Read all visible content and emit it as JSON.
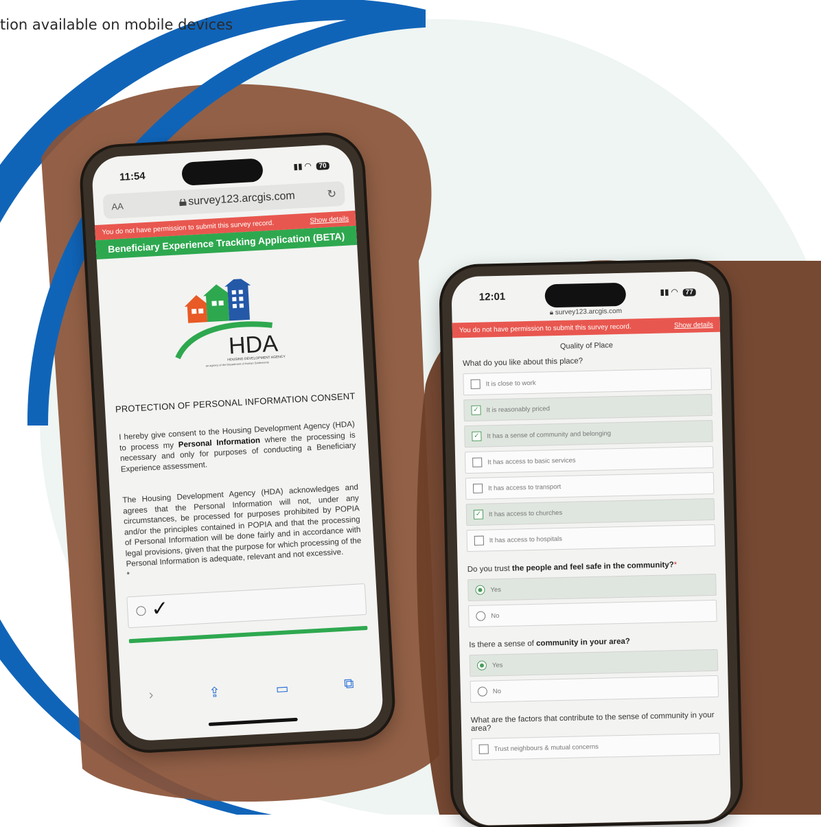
{
  "caption": "tion available on mobile devices",
  "colors": {
    "accent_blue": "#1064b8",
    "green": "#2ea84f",
    "warning_red": "#e8574f"
  },
  "phone1": {
    "time": "11:54",
    "battery": "70",
    "aa_label": "AA",
    "url": "survey123.arcgis.com",
    "warning": "You do not have permission to submit this survey record.",
    "show_details": "Show details",
    "app_title": "Beneficiary Experience Tracking Application (BETA)",
    "logo_text": "HDA",
    "logo_sub": "HOUSING DEVELOPMENT AGENCY",
    "logo_sub2": "an agency of the Department of Human Settlements",
    "consent_title": "PROTECTION OF PERSONAL INFORMATION CONSENT",
    "para1_before": "I hereby give consent to the Housing Development Agency (HDA) to process my ",
    "para1_bold": "Personal Information",
    "para1_after": " where the processing is necessary and only for purposes of conducting a Beneficiary Experience assessment.",
    "para2": "The Housing Development Agency (HDA) acknowledges and agrees that the Personal Information will not, under any circumstances, be processed for purposes prohibited by POPIA and/or the principles contained in POPIA and that the processing of Personal Information will be done fairly and in accordance with legal provisions, given that the purpose for which processing of the Personal Information is adequate, relevant and not excessive.",
    "required_mark": "*",
    "toolbar": {
      "forward": "›",
      "share": "⇪",
      "bookmarks": "📖",
      "tabs": "⧉"
    }
  },
  "phone2": {
    "time": "12:01",
    "battery": "77",
    "url": "survey123.arcgis.com",
    "warning": "You do not have permission to submit this survey record.",
    "show_details": "Show details",
    "section_title": "Quality of Place",
    "q1": "What do you like about this place?",
    "q1_options": [
      {
        "label": "It is close to work",
        "checked": false
      },
      {
        "label": "It is reasonably priced",
        "checked": true
      },
      {
        "label": "It has a sense of community and belonging",
        "checked": true
      },
      {
        "label": "It has access to basic services",
        "checked": false
      },
      {
        "label": "It has access to transport",
        "checked": false
      },
      {
        "label": "It has access to churches",
        "checked": true
      },
      {
        "label": "It has access to hospitals",
        "checked": false
      }
    ],
    "q2_before": "Do you trust ",
    "q2_bold": "the people and feel safe in the community?",
    "q2_mark": "*",
    "q2_yes": "Yes",
    "q2_no": "No",
    "q3_before": "Is there a sense of ",
    "q3_bold": "community in your area?",
    "q3_yes": "Yes",
    "q3_no": "No",
    "q4": "What are the factors that contribute to the sense of community in your area?",
    "q4_opt1": "Trust neighbours & mutual concerns"
  }
}
